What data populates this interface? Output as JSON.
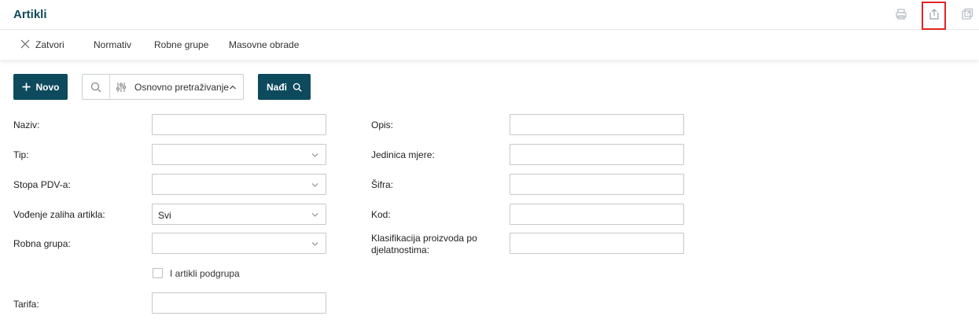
{
  "header": {
    "title": "Artikli",
    "icons": [
      "print-icon",
      "share-export-icon",
      "open-external-icon"
    ],
    "highlight_color": "#e02424"
  },
  "toolbar": {
    "close_label": "Zatvori",
    "items": [
      "Normativ",
      "Robne grupe",
      "Masovne obrade"
    ]
  },
  "actions": {
    "new_label": "Novo",
    "search_mode_label": "Osnovno pretraživanje",
    "find_label": "Nađi"
  },
  "form": {
    "left": {
      "naziv": {
        "label": "Naziv:",
        "value": ""
      },
      "tip": {
        "label": "Tip:",
        "value": ""
      },
      "stopa_pdv": {
        "label": "Stopa PDV-a:",
        "value": ""
      },
      "vodenje_zaliha": {
        "label": "Vođenje zaliha artikla:",
        "value": "Svi"
      },
      "robna_grupa": {
        "label": "Robna grupa:",
        "value": ""
      },
      "podgrupe_checkbox": {
        "label": "I artikli podgrupa",
        "checked": false
      },
      "tarifa": {
        "label": "Tarifa:",
        "value": ""
      }
    },
    "right": {
      "opis": {
        "label": "Opis:",
        "value": ""
      },
      "jedinica_mjere": {
        "label": "Jedinica mjere:",
        "value": ""
      },
      "sifra": {
        "label": "Šifra:",
        "value": ""
      },
      "kod": {
        "label": "Kod:",
        "value": ""
      },
      "klasifikacija": {
        "label": "Klasifikacija proizvoda po djelatnostima:",
        "value": ""
      }
    }
  },
  "colors": {
    "brand": "#0d4a5d",
    "border": "#c4c9ce"
  }
}
